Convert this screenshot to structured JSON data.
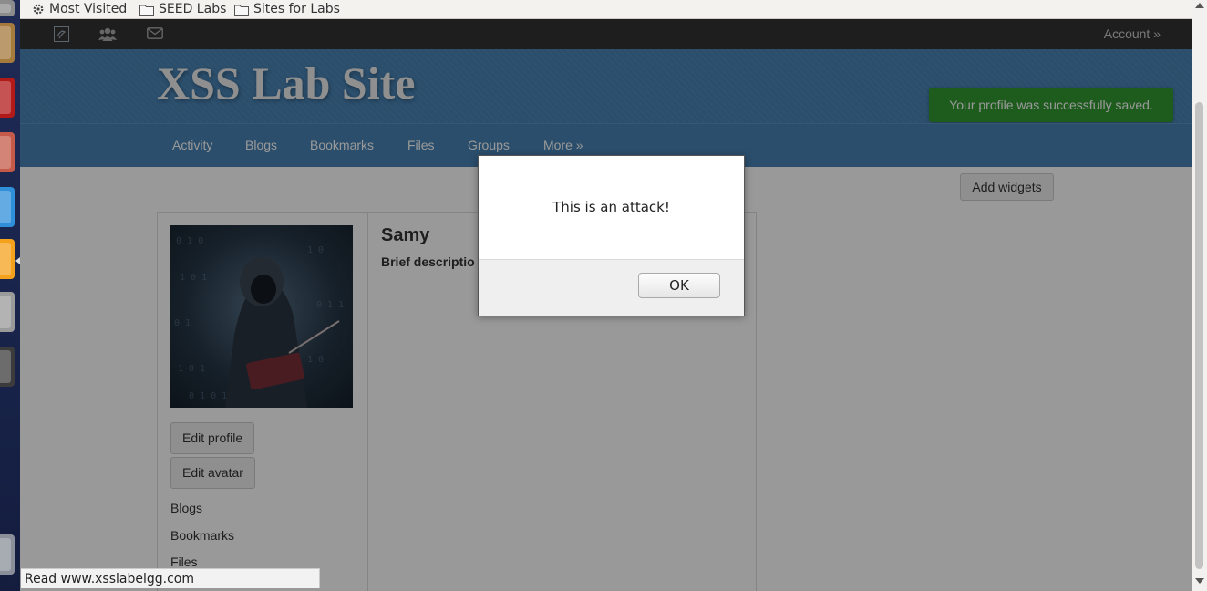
{
  "bookmarks": {
    "items": [
      {
        "label": "Most Visited",
        "icon": "gear-icon"
      },
      {
        "label": "SEED Labs",
        "icon": "folder-icon"
      },
      {
        "label": "Sites for Labs",
        "icon": "folder-icon"
      }
    ]
  },
  "topbar": {
    "icons": [
      "elgg-logo-icon",
      "friends-icon",
      "messages-icon"
    ],
    "account_label": "Account »"
  },
  "header": {
    "site_title": "XSS Lab Site",
    "flash_message": "Your profile was successfully saved."
  },
  "nav": {
    "items": [
      "Activity",
      "Blogs",
      "Bookmarks",
      "Files",
      "Groups",
      "More »"
    ]
  },
  "content": {
    "add_widgets_label": "Add widgets",
    "profile": {
      "name": "Samy",
      "brief_description_label": "Brief descriptio",
      "buttons": [
        "Edit profile",
        "Edit avatar"
      ],
      "links": [
        "Blogs",
        "Bookmarks",
        "Files"
      ]
    }
  },
  "statusbar": {
    "text": "Read www.xsslabelgg.com"
  },
  "dialog": {
    "message": "This is an attack!",
    "ok_label": "OK"
  },
  "colors": {
    "header_blue": "#4682b4",
    "topbar": "#333333",
    "flash_green": "#339933",
    "launcher": "#1f2b55"
  }
}
